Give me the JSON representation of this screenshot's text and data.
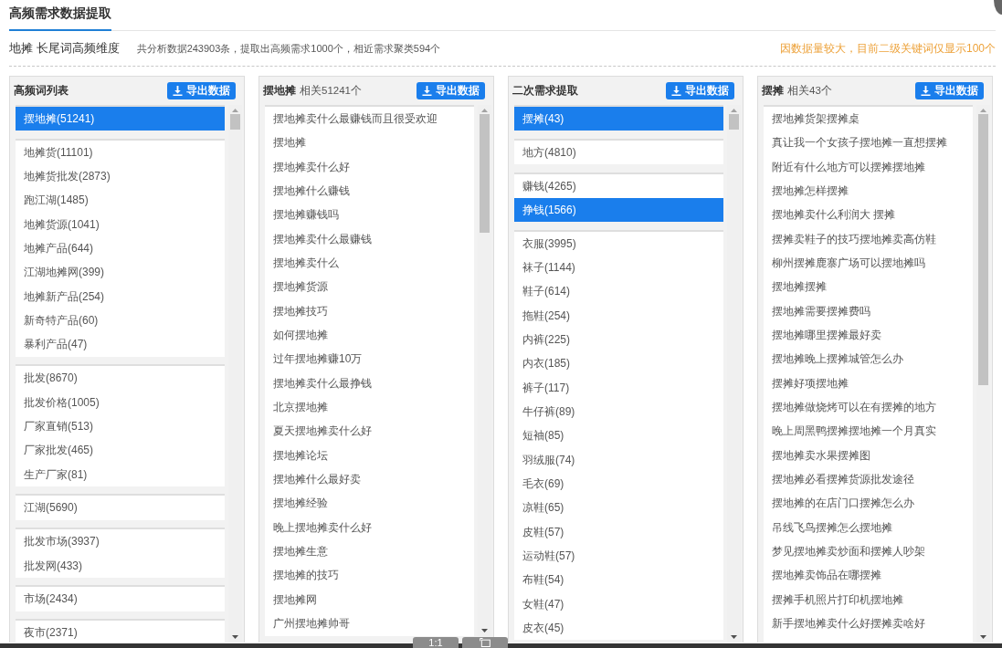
{
  "tabs": [
    {
      "label": "高频需求数据提取",
      "selected": true
    }
  ],
  "summary": {
    "keyword": "地摊 长尾词高频维度",
    "stats": "共分析数据243903条，提取出高频需求1000个，相近需求聚类594个",
    "notice": "因数据量较大，目前二级关键词仅显示100个"
  },
  "panels": [
    {
      "title": "高频词列表",
      "export_button": "导出数据",
      "kind": "grouped",
      "groups": [
        {
          "items": [
            {
              "label": "摆地摊(51241)",
              "selected": true
            }
          ]
        },
        {
          "items": [
            {
              "label": "地摊货(11101)",
              "selected": false
            },
            {
              "label": "地摊货批发(2873)",
              "selected": false
            },
            {
              "label": "跑江湖(1485)",
              "selected": false
            },
            {
              "label": "地摊货源(1041)",
              "selected": false
            },
            {
              "label": "地摊产品(644)",
              "selected": false
            },
            {
              "label": "江湖地摊网(399)",
              "selected": false
            },
            {
              "label": "地摊新产品(254)",
              "selected": false
            },
            {
              "label": "新奇特产品(60)",
              "selected": false
            },
            {
              "label": "暴利产品(47)",
              "selected": false
            }
          ]
        },
        {
          "items": [
            {
              "label": "批发(8670)",
              "selected": false
            },
            {
              "label": "批发价格(1005)",
              "selected": false
            },
            {
              "label": "厂家直销(513)",
              "selected": false
            },
            {
              "label": "厂家批发(465)",
              "selected": false
            },
            {
              "label": "生产厂家(81)",
              "selected": false
            }
          ]
        },
        {
          "items": [
            {
              "label": "江湖(5690)",
              "selected": false
            }
          ]
        },
        {
          "items": [
            {
              "label": "批发市场(3937)",
              "selected": false
            },
            {
              "label": "批发网(433)",
              "selected": false
            }
          ]
        },
        {
          "items": [
            {
              "label": "市场(2434)",
              "selected": false
            }
          ]
        },
        {
          "items": [
            {
              "label": "夜市(2371)",
              "selected": false
            }
          ]
        }
      ]
    },
    {
      "title": "摆地摊",
      "count": "相关51241个",
      "export_button": "导出数据",
      "kind": "plain",
      "items": [
        "摆地摊卖什么最赚钱而且很受欢迎",
        "摆地摊",
        "摆地摊卖什么好",
        "摆地摊什么赚钱",
        "摆地摊赚钱吗",
        "摆地摊卖什么最赚钱",
        "摆地摊卖什么",
        "摆地摊货源",
        "摆地摊技巧",
        "如何摆地摊",
        "过年摆地摊赚10万",
        "摆地摊卖什么最挣钱",
        "北京摆地摊",
        "夏天摆地摊卖什么好",
        "摆地摊论坛",
        "摆地摊什么最好卖",
        "摆地摊经验",
        "晚上摆地摊卖什么好",
        "摆地摊生意",
        "摆地摊的技巧",
        "摆地摊网",
        "广州摆地摊帅哥"
      ]
    },
    {
      "title": "二次需求提取",
      "export_button": "导出数据",
      "kind": "grouped",
      "groups": [
        {
          "items": [
            {
              "label": "摆摊(43)",
              "selected": true
            }
          ]
        },
        {
          "items": [
            {
              "label": "地方(4810)",
              "selected": false
            }
          ]
        },
        {
          "items": [
            {
              "label": "赚钱(4265)",
              "selected": false
            },
            {
              "label": "挣钱(1566)",
              "selected": true
            }
          ]
        },
        {
          "items": [
            {
              "label": "衣服(3995)",
              "selected": false
            },
            {
              "label": "袜子(1144)",
              "selected": false
            },
            {
              "label": "鞋子(614)",
              "selected": false
            },
            {
              "label": "拖鞋(254)",
              "selected": false
            },
            {
              "label": "内裤(225)",
              "selected": false
            },
            {
              "label": "内衣(185)",
              "selected": false
            },
            {
              "label": "裤子(117)",
              "selected": false
            },
            {
              "label": "牛仔裤(89)",
              "selected": false
            },
            {
              "label": "短袖(85)",
              "selected": false
            },
            {
              "label": "羽绒服(74)",
              "selected": false
            },
            {
              "label": "毛衣(69)",
              "selected": false
            },
            {
              "label": "凉鞋(65)",
              "selected": false
            },
            {
              "label": "皮鞋(57)",
              "selected": false
            },
            {
              "label": "运动鞋(57)",
              "selected": false
            },
            {
              "label": "布鞋(54)",
              "selected": false
            },
            {
              "label": "女鞋(47)",
              "selected": false
            },
            {
              "label": "皮衣(45)",
              "selected": false
            }
          ]
        }
      ]
    },
    {
      "title": "摆摊",
      "count": "相关43个",
      "export_button": "导出数据",
      "kind": "plain",
      "items": [
        "摆地摊货架摆摊桌",
        "真让我一个女孩子摆地摊一直想摆摊",
        "附近有什么地方可以摆摊摆地摊",
        "摆地摊怎样摆摊",
        "摆地摊卖什么利润大 摆摊",
        "摆摊卖鞋子的技巧摆地摊卖高仿鞋",
        "柳州摆摊鹿寨广场可以摆地摊吗",
        "摆地摊摆摊",
        "摆地摊需要摆摊费吗",
        "摆地摊哪里摆摊最好卖",
        "摆地摊晚上摆摊城管怎么办",
        "摆摊好项摆地摊",
        "摆地摊做烧烤可以在有摆摊的地方",
        "晚上周黑鸭摆摊摆地摊一个月真实",
        "摆地摊卖水果摆摊图",
        "摆地摊必看摆摊货源批发途径",
        "摆地摊的在店门口摆摊怎么办",
        "吊线飞鸟摆摊怎么摆地摊",
        "梦见摆地摊卖炒面和摆摊人吵架",
        "摆地摊卖饰品在哪摆摊",
        "摆摊手机照片打印机摆地摊",
        "新手摆地摊卖什么好摆摊卖啥好"
      ]
    }
  ],
  "viewer_toolbar": {
    "zoom_button": "1:1"
  }
}
